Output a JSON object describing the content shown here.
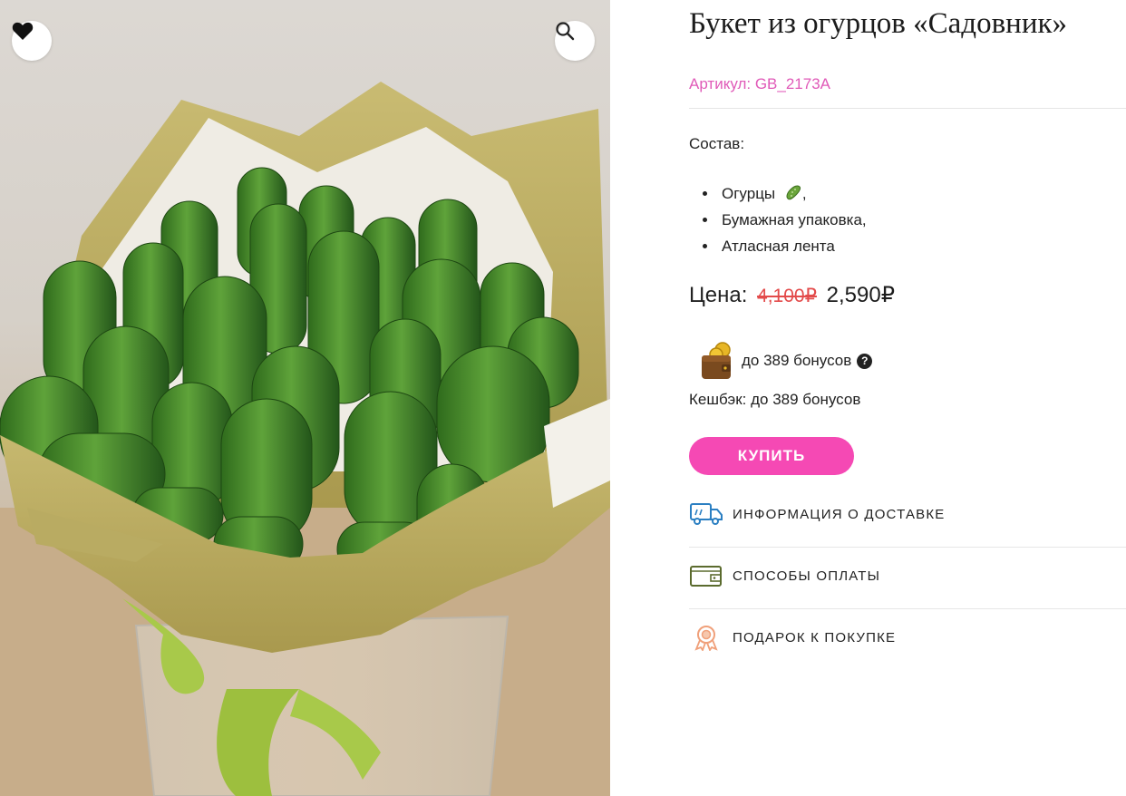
{
  "product": {
    "title": "Букет из огурцов «Садовник»",
    "sku": "Артикул: GB_2173A"
  },
  "gallery": {
    "favorite_icon": "heart-icon",
    "zoom_icon": "search-icon"
  },
  "composition": {
    "label": "Состав:",
    "items": [
      "Огурцы",
      "Бумажная упаковка,",
      "Атласная лента"
    ],
    "first_item_suffix": ",",
    "first_item_icon": "cucumber-icon"
  },
  "price": {
    "label": "Цена:",
    "old": "4,100₽",
    "new": "2,590₽"
  },
  "bonus": {
    "text": "до 389 бонусов",
    "help_icon": "question-icon",
    "help_glyph": "?",
    "wallet_icon": "wallet-coins-icon",
    "cashback": "Кешбэк: до 389 бонусов"
  },
  "buy_button": {
    "label": "КУПИТЬ",
    "color": "#f549b4"
  },
  "links": [
    {
      "label": "ИНФОРМАЦИЯ О ДОСТАВКЕ",
      "icon": "delivery-truck-icon",
      "color": "#2b7fc2"
    },
    {
      "label": "СПОСОБЫ ОПЛАТЫ",
      "icon": "wallet-icon",
      "color": "#5b6b2e"
    },
    {
      "label": "ПОДАРОК К ПОКУПКЕ",
      "icon": "gift-badge-icon",
      "color": "#f0a07a"
    }
  ],
  "colors": {
    "accent": "#f549b4",
    "sku": "#e05ab8",
    "old_price": "#e34b4b"
  }
}
